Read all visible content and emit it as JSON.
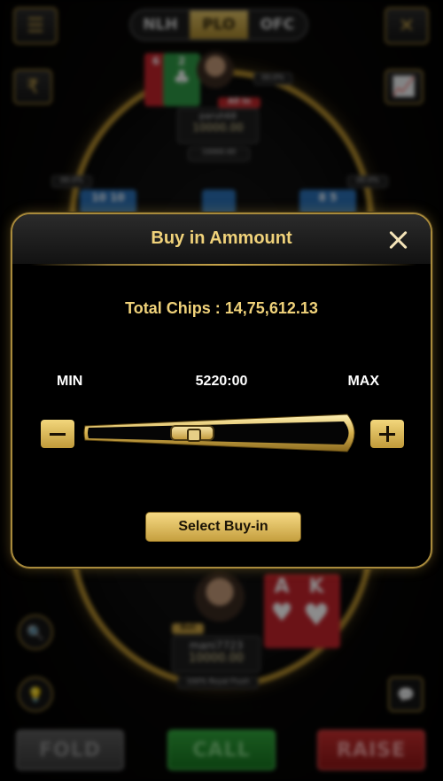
{
  "game_tabs": [
    {
      "label": "NLH"
    },
    {
      "label": "PLO",
      "active": true
    },
    {
      "label": "OFC"
    }
  ],
  "top_player": {
    "name": "paruh68",
    "chips": "10000.00",
    "status": "All In",
    "percent": "00.0%",
    "card1": "6",
    "card2": "2"
  },
  "left_player": {
    "percent": "00.0%",
    "cards": "10 10"
  },
  "right_player": {
    "percent": "00.0%",
    "cards": "8 5"
  },
  "pot_text": "10000.00",
  "bottom_player": {
    "name": "mani7723",
    "chips": "10000.00",
    "action": "Bet",
    "hand": "100% Royal Flush",
    "card1": "A",
    "card2": "K"
  },
  "actions": {
    "fold": "FOLD",
    "call": "CALL",
    "raise": "RAISE"
  },
  "modal": {
    "title": "Buy in Ammount",
    "total_chips": "Total Chips : 14,75,612.13",
    "min_label": "MIN",
    "max_label": "MAX",
    "current_value": "5220:00",
    "slider_fraction": 0.4,
    "select_label": "Select Buy-in"
  },
  "colors": {
    "gold": "#f0d27a",
    "accent": "#c8a54a",
    "call": "#17751f",
    "raise": "#8d1515"
  },
  "icons": [
    "menu-icon",
    "close-icon",
    "rupee-icon",
    "chart-icon",
    "search-zoom-icon",
    "bulb-icon",
    "chat-icon"
  ]
}
